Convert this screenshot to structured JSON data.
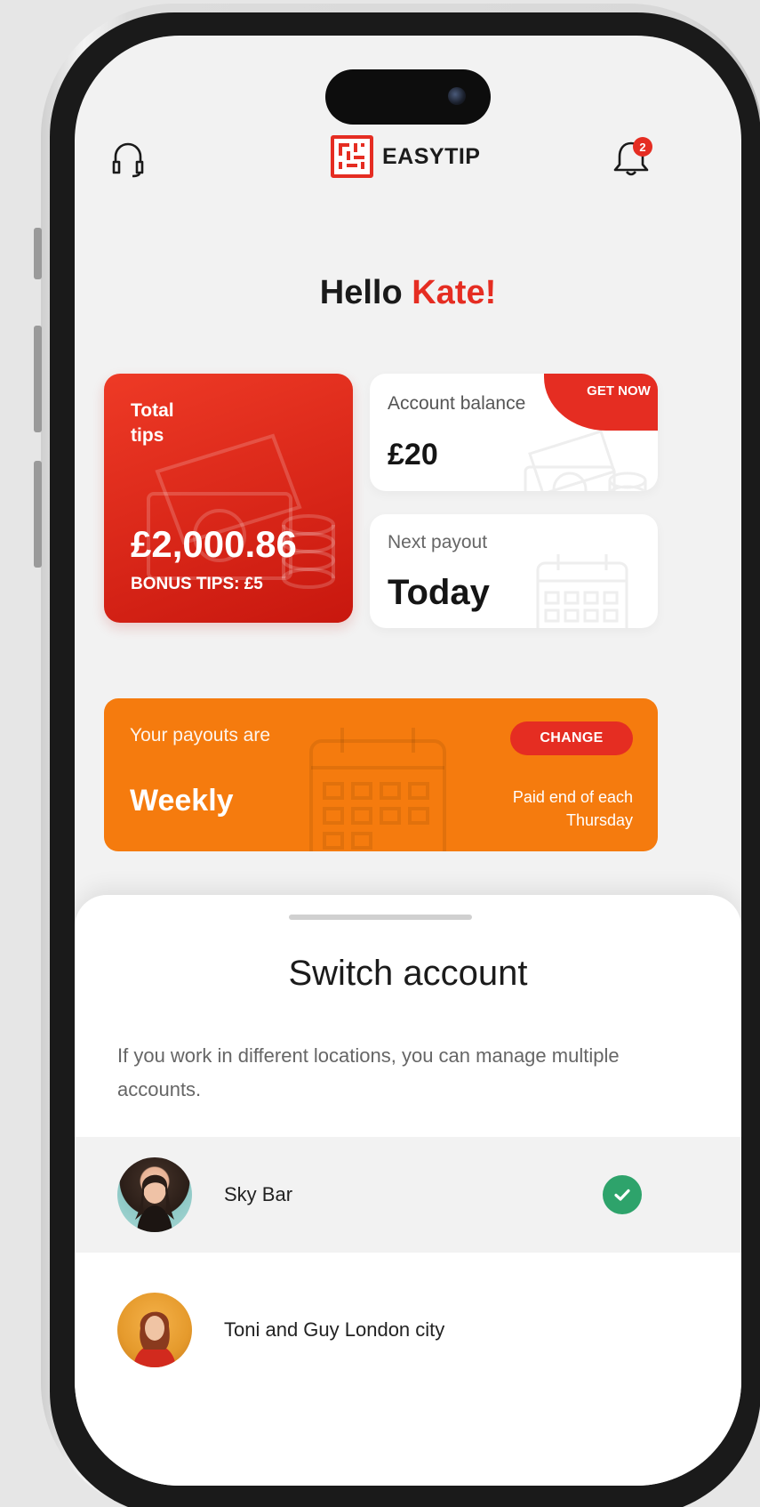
{
  "header": {
    "brand": "EASYTIP",
    "notification_count": "2"
  },
  "greeting": {
    "hello": "Hello",
    "name": "Kate!"
  },
  "cards": {
    "total_tips": {
      "label": "Total tips",
      "amount": "£2,000.86",
      "bonus": "BONUS TIPS: £5"
    },
    "account_balance": {
      "label": "Account balance",
      "amount": "£20",
      "action": "GET NOW"
    },
    "next_payout": {
      "label": "Next payout",
      "value": "Today"
    },
    "payout_schedule": {
      "label": "Your payouts are",
      "value": "Weekly",
      "action": "CHANGE",
      "note": "Paid end of each Thursday"
    }
  },
  "sheet": {
    "title": "Switch account",
    "description": "If you work in different locations, you can manage multiple accounts.",
    "accounts": [
      {
        "name": "Sky Bar",
        "selected": true
      },
      {
        "name": "Toni and Guy London city",
        "selected": false
      }
    ]
  },
  "colors": {
    "brand_red": "#e52d22",
    "orange": "#f57b0e",
    "check_green": "#2ea36b"
  },
  "icons": [
    "headset-icon",
    "bell-icon",
    "check-icon",
    "money-icon",
    "calendar-icon"
  ]
}
